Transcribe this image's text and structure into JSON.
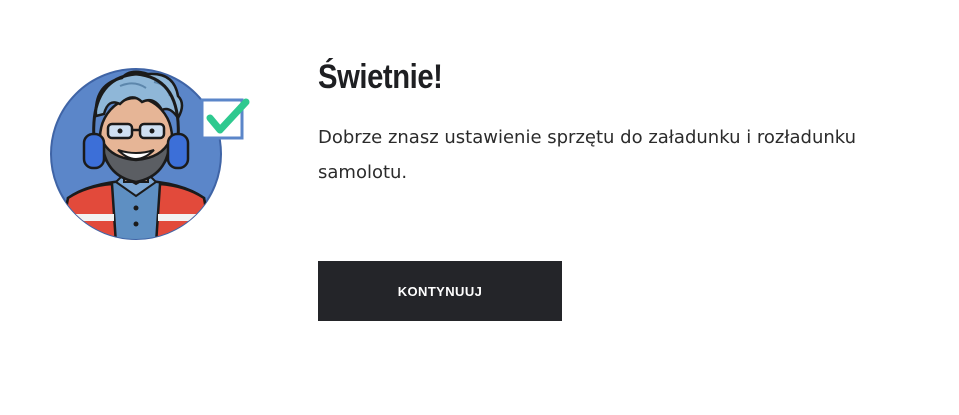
{
  "result": {
    "title": "Świetnie!",
    "message": "Dobrze znasz ustawienie sprzętu do załadunku i rozładunku samolotu.",
    "continue_label": "KONTYNUUJ"
  },
  "avatar": {
    "icon": "ground-crew-worker-avatar",
    "badge_icon": "checkmark-icon"
  },
  "colors": {
    "avatar_background": "#5b86c9",
    "check_green": "#2ec98f",
    "vest_red": "#e24a3b",
    "button_background": "#242529",
    "title": "#1e1f22"
  }
}
